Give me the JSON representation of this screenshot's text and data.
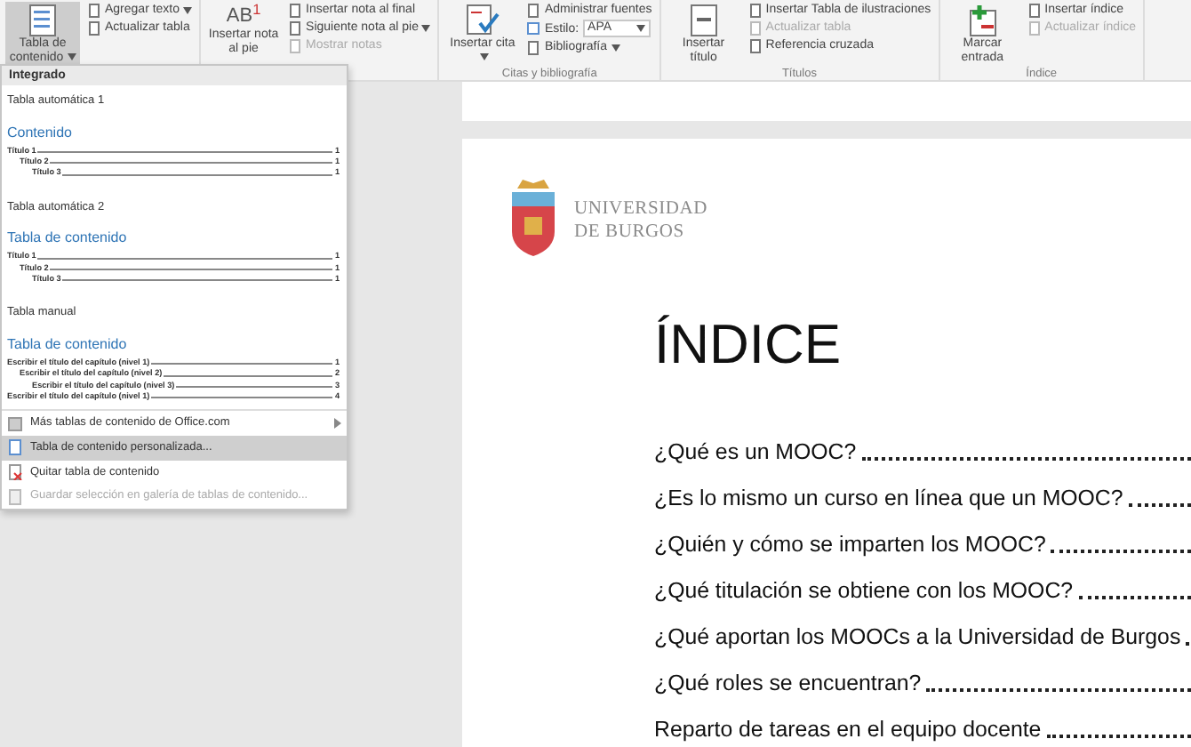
{
  "ribbon": {
    "groups": [
      {
        "large": [
          {
            "label": "Tabla de contenido",
            "dropdown": true,
            "selected": true
          }
        ],
        "small": [
          {
            "label": "Agregar texto",
            "dropdown": true,
            "disabled": false,
            "kind": "button"
          },
          {
            "label": "Actualizar tabla",
            "dropdown": false,
            "disabled": false,
            "kind": "button"
          }
        ]
      },
      {
        "large": [
          {
            "label": "Insertar nota al pie",
            "dropdown": false,
            "selected": false,
            "glyph": "AB",
            "sup": "1"
          }
        ],
        "small": [
          {
            "label": "Insertar nota al final",
            "dropdown": false,
            "disabled": false,
            "kind": "button"
          },
          {
            "label": "Siguiente nota al pie",
            "dropdown": true,
            "disabled": false,
            "kind": "button"
          },
          {
            "label": "Mostrar notas",
            "dropdown": false,
            "disabled": true,
            "kind": "button"
          }
        ]
      },
      {
        "label": "Citas y bibliografía",
        "large": [
          {
            "label": "Insertar cita",
            "dropdown": true,
            "selected": false
          }
        ],
        "small": [
          {
            "label": "Administrar fuentes",
            "dropdown": false,
            "disabled": false,
            "kind": "button"
          },
          {
            "label": "Estilo:",
            "value": "APA",
            "dropdown": true,
            "disabled": false,
            "kind": "field"
          },
          {
            "label": "Bibliografía",
            "dropdown": true,
            "disabled": false,
            "kind": "button"
          }
        ]
      },
      {
        "label": "Títulos",
        "large": [
          {
            "label": "Insertar título",
            "dropdown": false,
            "selected": false
          }
        ],
        "small": [
          {
            "label": "Insertar Tabla de ilustraciones",
            "dropdown": false,
            "disabled": false,
            "kind": "button"
          },
          {
            "label": "Actualizar tabla",
            "dropdown": false,
            "disabled": true,
            "kind": "button"
          },
          {
            "label": "Referencia cruzada",
            "dropdown": false,
            "disabled": false,
            "kind": "button"
          }
        ]
      },
      {
        "label": "Índice",
        "large": [
          {
            "label": "Marcar entrada",
            "dropdown": false,
            "selected": false
          }
        ],
        "small": [
          {
            "label": "Insertar índice",
            "dropdown": false,
            "disabled": false,
            "kind": "button"
          },
          {
            "label": "Actualizar índice",
            "dropdown": false,
            "disabled": true,
            "kind": "button"
          }
        ]
      }
    ]
  },
  "dropdown": {
    "header": "Integrado",
    "sections": [
      {
        "title": "Tabla automática 1",
        "heading": "Contenido",
        "entries": [
          {
            "text": "Título 1",
            "page": "1",
            "children": [
              {
                "text": "Título 2",
                "page": "1",
                "children": [
                  {
                    "text": "Título 3",
                    "page": "1"
                  }
                ]
              }
            ]
          }
        ]
      },
      {
        "title": "Tabla automática 2",
        "heading": "Tabla de contenido",
        "entries": [
          {
            "text": "Título 1",
            "page": "1",
            "children": [
              {
                "text": "Título 2",
                "page": "1",
                "children": [
                  {
                    "text": "Título 3",
                    "page": "1"
                  }
                ]
              }
            ]
          }
        ]
      },
      {
        "title": "Tabla manual",
        "heading": "Tabla de contenido",
        "entries": [
          {
            "text": "Escribir el título del capítulo (nivel 1)",
            "page": "1",
            "children": [
              {
                "text": "Escribir el título del capítulo (nivel 2)",
                "page": "2",
                "children": [
                  {
                    "text": "Escribir el título del capítulo (nivel 3)",
                    "page": "3"
                  }
                ]
              }
            ]
          },
          {
            "text": "Escribir el título del capítulo (nivel 1)",
            "page": "4"
          }
        ]
      }
    ],
    "menu_items": [
      {
        "label": "Más tablas de contenido de Office.com",
        "submenu": true,
        "selected": false,
        "disabled": false
      },
      {
        "label": "Tabla de contenido personalizada...",
        "submenu": false,
        "selected": true,
        "disabled": false
      },
      {
        "label": "Quitar tabla de contenido",
        "submenu": false,
        "selected": false,
        "disabled": false
      },
      {
        "label": "Guardar selección en galería de tablas de contenido...",
        "submenu": false,
        "selected": false,
        "disabled": true
      }
    ]
  },
  "document": {
    "logo_lines": [
      "UNIVERSIDAD",
      "DE BURGOS"
    ],
    "title": "ÍNDICE",
    "toc": [
      {
        "text": "¿Qué es un MOOC?"
      },
      {
        "text": "¿Es lo mismo un curso en línea que un MOOC?"
      },
      {
        "text": "¿Quién y cómo se imparten los MOOC?"
      },
      {
        "text": "¿Qué titulación se obtiene con los MOOC?"
      },
      {
        "text": "¿Qué aportan los MOOCs a la Universidad de Burgos"
      },
      {
        "text": "¿Qué roles se encuentran?"
      },
      {
        "text": "Reparto de tareas en el equipo docente"
      }
    ]
  }
}
